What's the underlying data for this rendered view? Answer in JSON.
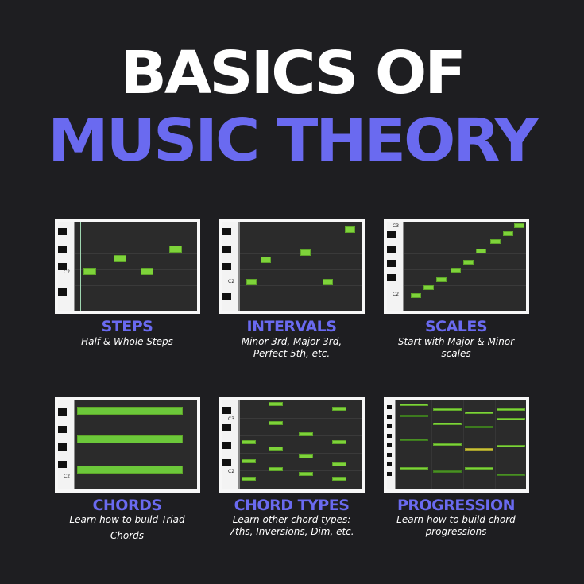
{
  "title": {
    "line1": "BASICS OF",
    "line2": "MUSIC THEORY"
  },
  "colors": {
    "accent": "#6a6af0",
    "note": "#7ed33a",
    "background": "#1e1e21"
  },
  "cards": [
    {
      "label": "STEPS",
      "desc1": "Half & Whole Steps",
      "desc2": "",
      "key_label": "C2"
    },
    {
      "label": "INTERVALS",
      "desc1": "Minor 3rd, Major 3rd,",
      "desc2": "Perfect 5th, etc.",
      "key_label": "C2"
    },
    {
      "label": "SCALES",
      "desc1": "Start with Major & Minor",
      "desc2": "scales",
      "key_label": "C3",
      "key_label2": "C2"
    },
    {
      "label": "CHORDS",
      "desc1": "Learn how to build Triad",
      "desc2": "Chords",
      "key_label": "C2"
    },
    {
      "label": "CHORD TYPES",
      "desc1": "Learn other chord types:",
      "desc2": "7ths, Inversions, Dim, etc.",
      "key_label": "C3",
      "key_label2": "C2"
    },
    {
      "label": "PROGRESSION",
      "desc1": "Learn how to build chord",
      "desc2": "progressions"
    }
  ]
}
